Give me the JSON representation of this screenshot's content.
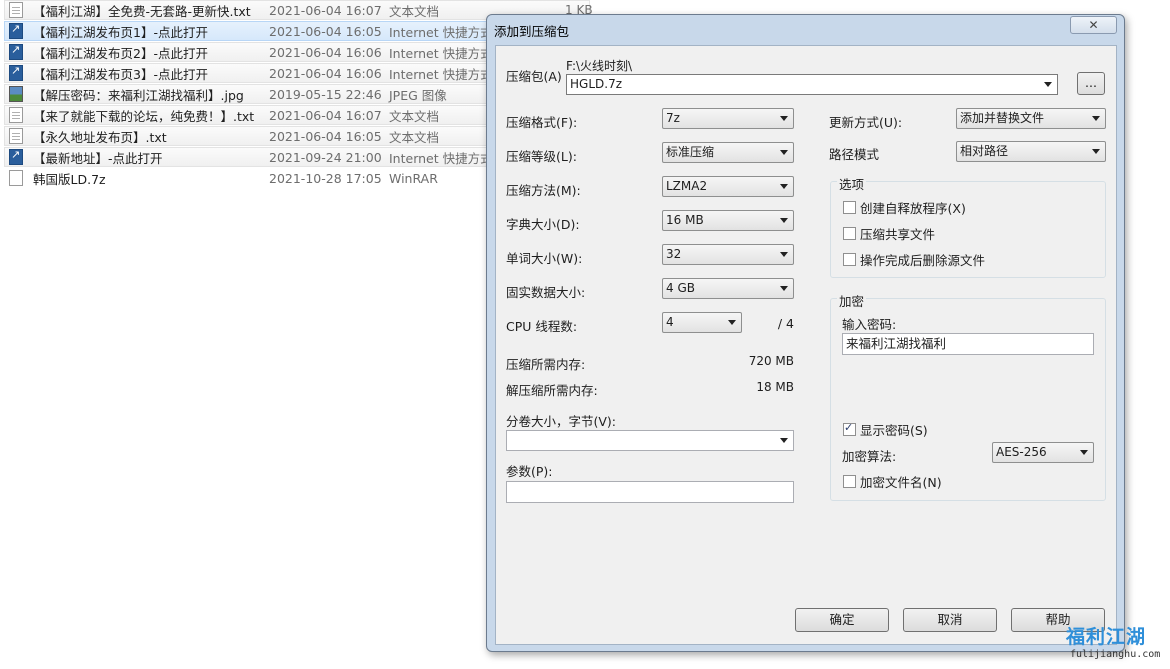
{
  "files": [
    {
      "icon": "text-file-icon",
      "name": "【福利江湖】全免费-无套路-更新快.txt",
      "date": "2021-06-04 16:07",
      "type": "文本文档",
      "size": "1 KB"
    },
    {
      "icon": "internet-shortcut-icon",
      "name": "【福利江湖发布页1】-点此打开",
      "date": "2021-06-04 16:05",
      "type": "Internet 快捷方式",
      "size": ""
    },
    {
      "icon": "internet-shortcut-icon",
      "name": "【福利江湖发布页2】-点此打开",
      "date": "2021-06-04 16:06",
      "type": "Internet 快捷方式",
      "size": ""
    },
    {
      "icon": "internet-shortcut-icon",
      "name": "【福利江湖发布页3】-点此打开",
      "date": "2021-06-04 16:06",
      "type": "Internet 快捷方式",
      "size": ""
    },
    {
      "icon": "image-file-icon",
      "name": "【解压密码：来福利江湖找福利】.jpg",
      "date": "2019-05-15 22:46",
      "type": "JPEG 图像",
      "size": ""
    },
    {
      "icon": "text-file-icon",
      "name": "【来了就能下载的论坛，纯免费！】.txt",
      "date": "2021-06-04 16:07",
      "type": "文本文档",
      "size": ""
    },
    {
      "icon": "text-file-icon",
      "name": "【永久地址发布页】.txt",
      "date": "2021-06-04 16:05",
      "type": "文本文档",
      "size": ""
    },
    {
      "icon": "internet-shortcut-icon",
      "name": "【最新地址】-点此打开",
      "date": "2021-09-24 21:00",
      "type": "Internet 快捷方式",
      "size": ""
    },
    {
      "icon": "archive-file-icon",
      "name": "韩国版LD.7z",
      "date": "2021-10-28 17:05",
      "type": "WinRAR",
      "size": ""
    }
  ],
  "dialog": {
    "title": "添加到压缩包",
    "close_label": "✕",
    "archive_label": "压缩包(A)",
    "archive_path": "F:\\火线时刻\\",
    "archive_name": "HGLD.7z",
    "browse_label": "...",
    "format_label": "压缩格式(F):",
    "format_value": "7z",
    "level_label": "压缩等级(L):",
    "level_value": "标准压缩",
    "method_label": "压缩方法(M):",
    "method_value": "LZMA2",
    "dict_label": "字典大小(D):",
    "dict_value": "16 MB",
    "word_label": "单词大小(W):",
    "word_value": "32",
    "solid_label": "固实数据大小:",
    "solid_value": "4 GB",
    "cpu_label": "CPU 线程数:",
    "cpu_value": "4",
    "cpu_total": "/ 4",
    "mem_comp_label": "压缩所需内存:",
    "mem_comp_value": "720 MB",
    "mem_decomp_label": "解压缩所需内存:",
    "mem_decomp_value": "18 MB",
    "volume_label": "分卷大小，字节(V):",
    "volume_value": "",
    "params_label": "参数(P):",
    "params_value": "",
    "update_label": "更新方式(U):",
    "update_value": "添加并替换文件",
    "pathmode_label": "路径模式",
    "pathmode_value": "相对路径",
    "options_title": "选项",
    "opt_sfx": "创建自释放程序(X)",
    "opt_shared": "压缩共享文件",
    "opt_delete": "操作完成后删除源文件",
    "encrypt_title": "加密",
    "password_label": "输入密码:",
    "password_value": "来福利江湖找福利",
    "show_password": "显示密码(S)",
    "enc_method_label": "加密算法:",
    "enc_method_value": "AES-256",
    "encrypt_names": "加密文件名(N)",
    "ok_label": "确定",
    "cancel_label": "取消",
    "help_label": "帮助"
  },
  "watermark": {
    "title": "福利江湖",
    "site": "fulijianghu.com"
  }
}
